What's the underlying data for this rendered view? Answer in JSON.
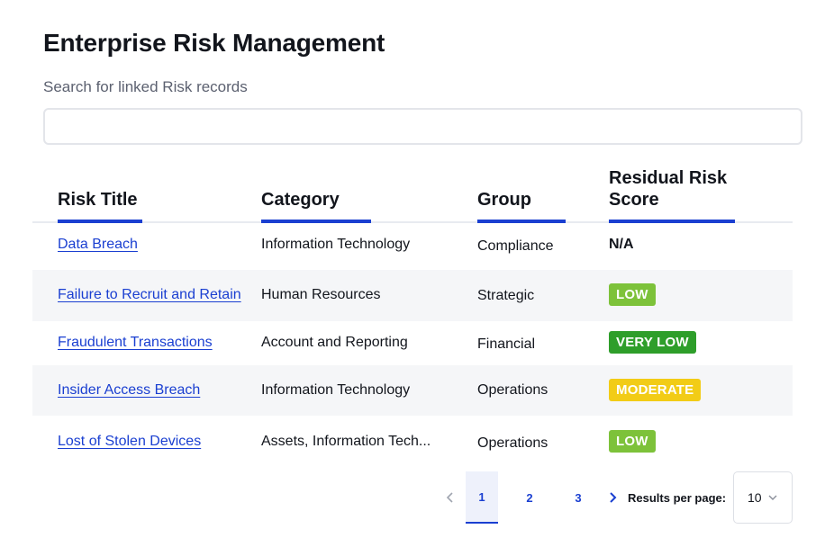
{
  "page": {
    "title": "Enterprise Risk Management",
    "search_label": "Search for linked Risk records",
    "search_value": "",
    "search_placeholder": ""
  },
  "table": {
    "columns": [
      "Risk Title",
      "Category",
      "Group",
      "Residual Risk Score"
    ],
    "rows": [
      {
        "title": "Data Breach",
        "category": "Information Technology",
        "group": "Compliance",
        "score": "N/A",
        "score_color": ""
      },
      {
        "title": "Failure to Recruit and Retain",
        "category": "Human Resources",
        "group": "Strategic",
        "score": "LOW",
        "score_color": "#7dc23a"
      },
      {
        "title": "Fraudulent Transactions",
        "category": "Account and Reporting",
        "group": "Financial",
        "score": "VERY LOW",
        "score_color": "#2e9e2a"
      },
      {
        "title": "Insider Access Breach",
        "category": "Information Technology",
        "group": "Operations",
        "score": "MODERATE",
        "score_color": "#f2cc16"
      },
      {
        "title": "Lost of Stolen Devices",
        "category": "Assets, Information Tech...",
        "group": "Operations",
        "score": "LOW",
        "score_color": "#7dc23a"
      }
    ]
  },
  "pagination": {
    "prev_icon": "chevron-left-icon",
    "pages": [
      "1",
      "2",
      "3"
    ],
    "current_page": "1",
    "next_icon": "chevron-right-icon",
    "results_label": "Results per page:",
    "results_per_page": "10"
  },
  "colors": {
    "accent": "#1a3fd1",
    "low": "#7dc23a",
    "very_low": "#2e9e2a",
    "moderate": "#f2cc16"
  }
}
